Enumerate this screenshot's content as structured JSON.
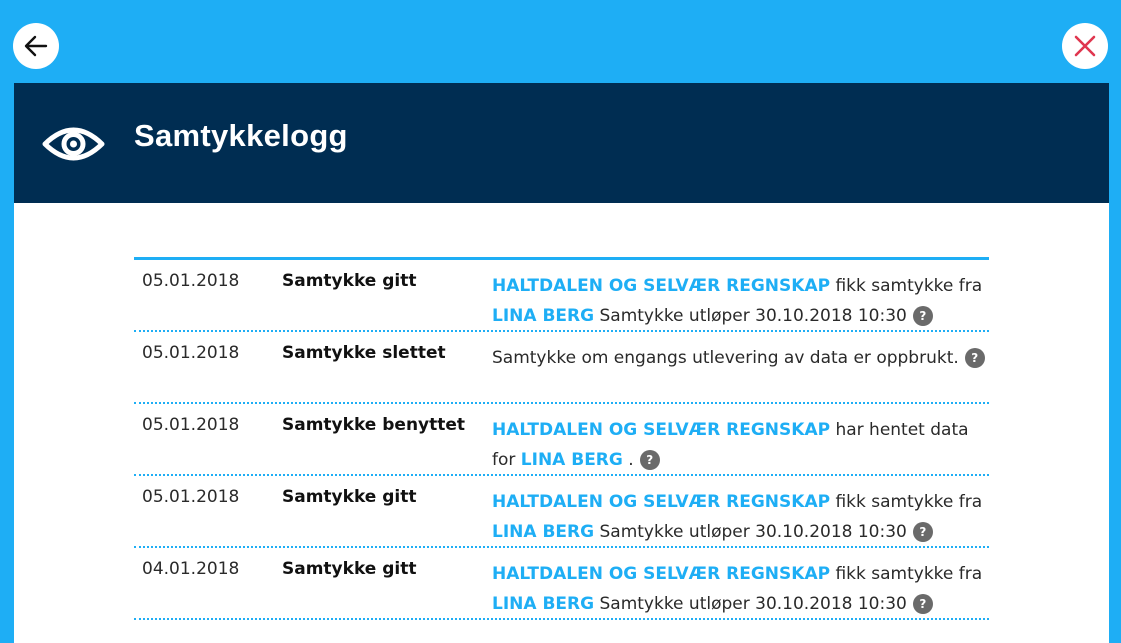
{
  "nav": {
    "back_icon": "arrow-left-icon",
    "close_icon": "close-x-icon",
    "close_color": "#e0364f"
  },
  "header": {
    "icon": "eye-icon",
    "title": "Samtykkelogg",
    "background": "#002d52"
  },
  "colors": {
    "accent": "#1eaef5",
    "help_icon": "#6a6a6a"
  },
  "log": {
    "rows": [
      {
        "date": "05.01.2018",
        "event": "Samtykke gitt",
        "parts": [
          {
            "type": "entity",
            "text": "HALTDALEN OG SELVÆR REGNSKAP"
          },
          {
            "type": "text",
            "text": " fikk samtykke fra "
          },
          {
            "type": "entity",
            "text": "LINA BERG"
          },
          {
            "type": "text",
            "text": " Samtykke utløper 30.10.2018 10:30"
          },
          {
            "type": "help",
            "text": "?"
          }
        ]
      },
      {
        "date": "05.01.2018",
        "event": "Samtykke slettet",
        "parts": [
          {
            "type": "text",
            "text": "Samtykke om engangs utlevering av data er oppbrukt."
          },
          {
            "type": "help",
            "text": "?"
          }
        ]
      },
      {
        "date": "05.01.2018",
        "event": "Samtykke benyttet",
        "parts": [
          {
            "type": "entity",
            "text": "HALTDALEN OG SELVÆR REGNSKAP"
          },
          {
            "type": "text",
            "text": " har hentet data for "
          },
          {
            "type": "entity",
            "text": "LINA BERG"
          },
          {
            "type": "text",
            "text": " ."
          },
          {
            "type": "help",
            "text": "?"
          }
        ]
      },
      {
        "date": "05.01.2018",
        "event": "Samtykke gitt",
        "parts": [
          {
            "type": "entity",
            "text": "HALTDALEN OG SELVÆR REGNSKAP"
          },
          {
            "type": "text",
            "text": " fikk samtykke fra "
          },
          {
            "type": "entity",
            "text": "LINA BERG"
          },
          {
            "type": "text",
            "text": " Samtykke utløper 30.10.2018 10:30"
          },
          {
            "type": "help",
            "text": "?"
          }
        ]
      },
      {
        "date": "04.01.2018",
        "event": "Samtykke gitt",
        "parts": [
          {
            "type": "entity",
            "text": "HALTDALEN OG SELVÆR REGNSKAP"
          },
          {
            "type": "text",
            "text": " fikk samtykke fra "
          },
          {
            "type": "entity",
            "text": "LINA BERG"
          },
          {
            "type": "text",
            "text": " Samtykke utløper 30.10.2018 10:30"
          },
          {
            "type": "help",
            "text": "?"
          }
        ]
      }
    ]
  }
}
